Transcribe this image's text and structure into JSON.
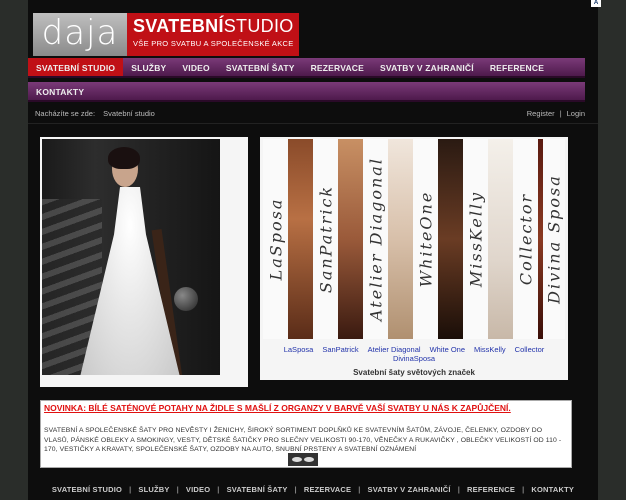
{
  "top_badge": "A",
  "logo": {
    "left_text": "daja",
    "title_bold": "SVATEBNÍ",
    "title_normal": "STUDIO",
    "subtitle": "VŠE PRO SVATBU A SPOLEČENSKÉ AKCE"
  },
  "nav": {
    "row1": [
      "SVATEBNÍ STUDIO",
      "SLUŽBY",
      "VIDEO",
      "SVATEBNÍ ŠATY",
      "REZERVACE",
      "SVATBY V ZAHRANIČÍ",
      "REFERENCE"
    ],
    "row2": [
      "KONTAKTY"
    ],
    "active": "SVATEBNÍ STUDIO"
  },
  "breadcrumb": {
    "label": "Nacházíte se zde:",
    "current": "Svatební studio"
  },
  "auth": {
    "register": "Register",
    "separator": "|",
    "login": "Login"
  },
  "brands": {
    "strip_labels": [
      "LaSposa",
      "SanPatrick",
      "Atelier Diagonal",
      "WhiteOne",
      "MissKelly",
      "Collector",
      "Divina Sposa"
    ],
    "links": [
      "LaSposa",
      "SanPatrick",
      "Atelier Diagonal",
      "White One",
      "MissKelly",
      "Collector",
      "DivinaSposa"
    ],
    "caption": "Svatební šaty světových značek"
  },
  "news": {
    "title": "NOVINKA: BÍLÉ SATÉNOVÉ POTAHY NA ŽIDLE S MAŠLÍ Z ORGANZY V BARVĚ VAŠÍ SVATBY U NÁS K ZAPŮJČENÍ.",
    "text": "SVATEBNÍ A SPOLEČENSKÉ ŠATY PRO NEVĚSTY I ŽENICHY, ŠIROKÝ SORTIMENT DOPLŇKŮ KE SVATEVNÍM ŠATŮM, ZÁVOJE, ČELENKY, OZDOBY DO VLASŮ, PÁNSKÉ OBLEKY A SMOKINGY, VESTY, DĚTSKÉ ŠATIČKY PRO SLEČNY VELIKOSTI 90-170, VĚNEČKY A RUKAVIČKY , OBLEČKY VELIKOSTÍ OD 110 - 170, VESTIČKY A KRAVATY, SPOLEČENSKÉ ŠATY, OZDOBY NA AUTO, SNUBNÍ PRSTENY A SVATEBNÍ OZNÁMENÍ"
  },
  "footer": {
    "items": [
      "SVATEBNÍ STUDIO",
      "SLUŽBY",
      "VIDEO",
      "SVATEBNÍ ŠATY",
      "REZERVACE",
      "SVATBY V ZAHRANIČÍ",
      "REFERENCE",
      "KONTAKTY"
    ],
    "separator": "|"
  }
}
